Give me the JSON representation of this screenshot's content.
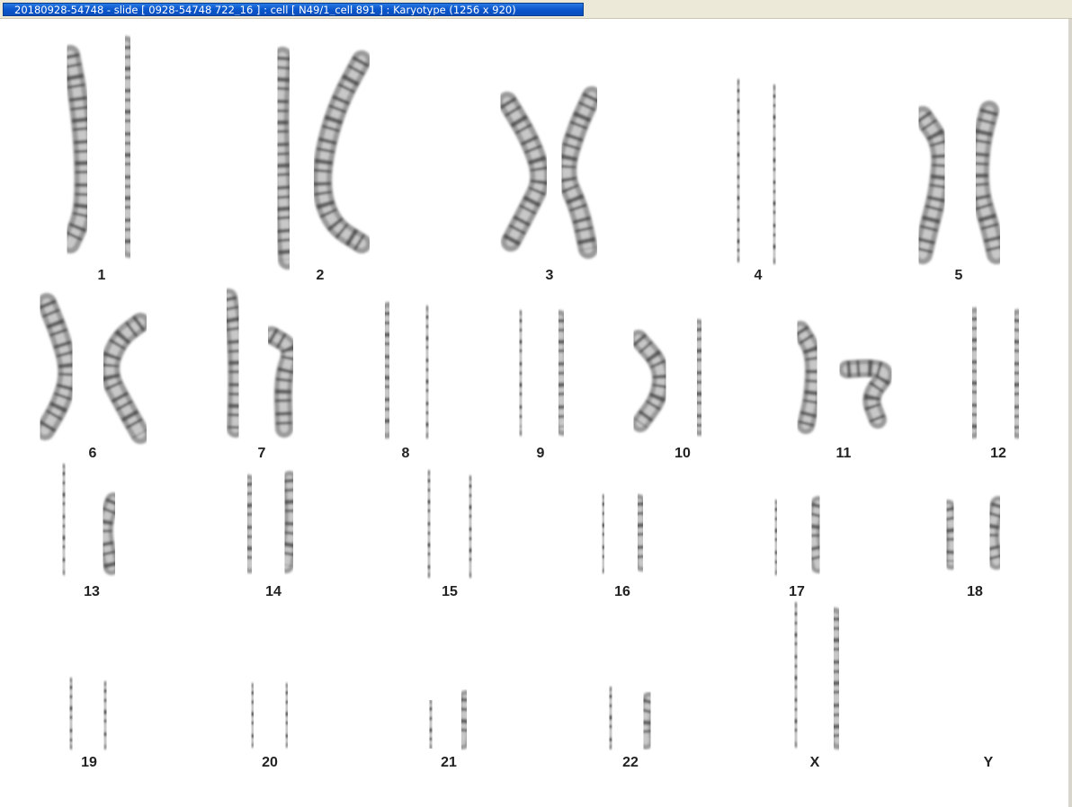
{
  "window": {
    "title": "20180928-54748 - slide [ 0928-54748 722_16 ] : cell [ N49/1_cell 891 ] : Karyotype  (1256 x 920)"
  },
  "karyotype": {
    "labels": [
      "1",
      "2",
      "3",
      "4",
      "5",
      "6",
      "7",
      "8",
      "9",
      "10",
      "11",
      "12",
      "13",
      "14",
      "15",
      "16",
      "17",
      "18",
      "19",
      "20",
      "21",
      "22",
      "X",
      "Y"
    ]
  },
  "colors": {
    "titlebar": "#0a56cc",
    "chromosome": "#8a8a8a",
    "band": "#3a3a3a"
  }
}
